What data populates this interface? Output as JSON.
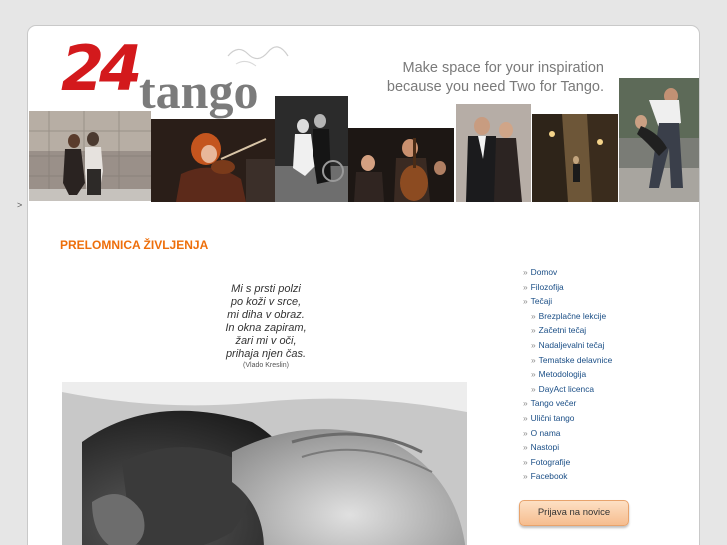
{
  "side_marker": ">",
  "header": {
    "logo_number": "24",
    "logo_word": "tango",
    "tagline_line1": "Make space for your inspiration",
    "tagline_line2": "because you need Two for Tango."
  },
  "article": {
    "title": "PRELOMNICA ŽIVLJENJA",
    "poem": [
      "Mi s prsti polzi",
      "po koži v srce,",
      "mi diha v obraz.",
      "In okna zapiram,",
      "žari mi v oči,",
      "prihaja njen čas."
    ],
    "author": "(Vlado Kreslin)"
  },
  "nav": {
    "bullet": "»",
    "items": [
      {
        "label": "Domov"
      },
      {
        "label": "Filozofija"
      },
      {
        "label": "Tečaji"
      },
      {
        "label": "Brezplačne lekcije"
      },
      {
        "label": "Začetni tečaj"
      },
      {
        "label": "Nadaljevalni tečaj"
      },
      {
        "label": "Tematske delavnice"
      },
      {
        "label": "Metodologija"
      },
      {
        "label": "DayAct licenca"
      },
      {
        "label": "Tango večer"
      },
      {
        "label": "Ulični tango"
      },
      {
        "label": "O nama"
      },
      {
        "label": "Nastopi"
      },
      {
        "label": "Fotografije"
      },
      {
        "label": "Facebook"
      }
    ]
  },
  "newsletter_button": "Prijava na novice",
  "colors": {
    "accent": "#ee6f0b",
    "link": "#1a4e86",
    "logo_red": "#d3191c"
  }
}
